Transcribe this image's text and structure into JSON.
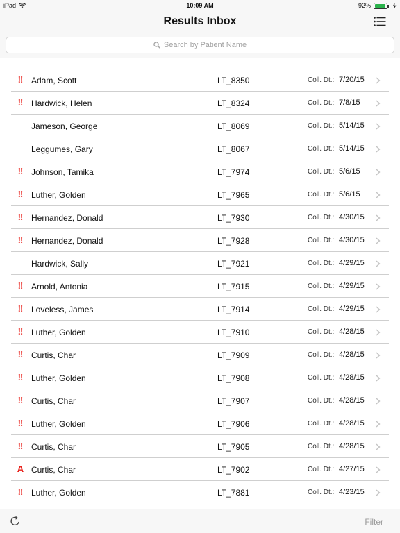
{
  "status_bar": {
    "device": "iPad",
    "time": "10:09 AM",
    "battery_percent": "92%",
    "battery_level": 0.92,
    "wifi_icon": "wifi-icon",
    "battery_icon": "battery-icon",
    "charging_icon": "charging-icon"
  },
  "header": {
    "title": "Results Inbox",
    "menu_icon": "list-menu-icon"
  },
  "search": {
    "placeholder": "Search by Patient Name",
    "icon": "search-icon"
  },
  "colors": {
    "flag_red": "#e8201a",
    "separator": "#cfcfcf",
    "bar_bg": "#f7f7f7",
    "filter_gray": "#9b9b9b"
  },
  "coll_label": "Coll. Dt.:",
  "results": [
    {
      "flag": "!!",
      "name": "Adam, Scott",
      "id": "LT_8350",
      "date": "7/20/15"
    },
    {
      "flag": "!!",
      "name": "Hardwick, Helen",
      "id": "LT_8324",
      "date": "7/8/15"
    },
    {
      "flag": "",
      "name": "Jameson, George",
      "id": "LT_8069",
      "date": "5/14/15"
    },
    {
      "flag": "",
      "name": "Leggumes, Gary",
      "id": "LT_8067",
      "date": "5/14/15"
    },
    {
      "flag": "!!",
      "name": "Johnson, Tamika",
      "id": "LT_7974",
      "date": "5/6/15"
    },
    {
      "flag": "!!",
      "name": "Luther, Golden",
      "id": "LT_7965",
      "date": "5/6/15"
    },
    {
      "flag": "!!",
      "name": "Hernandez, Donald",
      "id": "LT_7930",
      "date": "4/30/15"
    },
    {
      "flag": "!!",
      "name": "Hernandez, Donald",
      "id": "LT_7928",
      "date": "4/30/15"
    },
    {
      "flag": "",
      "name": "Hardwick, Sally",
      "id": "LT_7921",
      "date": "4/29/15"
    },
    {
      "flag": "!!",
      "name": "Arnold, Antonia",
      "id": "LT_7915",
      "date": "4/29/15"
    },
    {
      "flag": "!!",
      "name": "Loveless, James",
      "id": "LT_7914",
      "date": "4/29/15"
    },
    {
      "flag": "!!",
      "name": "Luther, Golden",
      "id": "LT_7910",
      "date": "4/28/15"
    },
    {
      "flag": "!!",
      "name": "Curtis, Char",
      "id": "LT_7909",
      "date": "4/28/15"
    },
    {
      "flag": "!!",
      "name": "Luther, Golden",
      "id": "LT_7908",
      "date": "4/28/15"
    },
    {
      "flag": "!!",
      "name": "Curtis, Char",
      "id": "LT_7907",
      "date": "4/28/15"
    },
    {
      "flag": "!!",
      "name": "Luther, Golden",
      "id": "LT_7906",
      "date": "4/28/15"
    },
    {
      "flag": "!!",
      "name": "Curtis, Char",
      "id": "LT_7905",
      "date": "4/28/15"
    },
    {
      "flag": "A",
      "name": "Curtis, Char",
      "id": "LT_7902",
      "date": "4/27/15"
    },
    {
      "flag": "!!",
      "name": "Luther, Golden",
      "id": "LT_7881",
      "date": "4/23/15"
    }
  ],
  "toolbar": {
    "refresh_icon": "refresh-icon",
    "filter_label": "Filter"
  }
}
